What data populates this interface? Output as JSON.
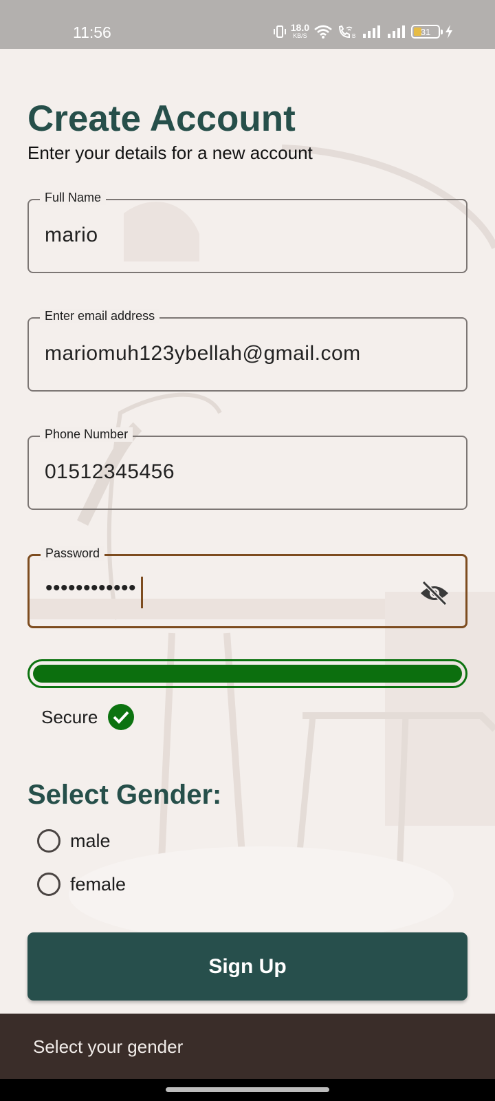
{
  "status_bar": {
    "time": "11:56",
    "net_speed_value": "18.0",
    "net_speed_unit": "KB/S",
    "battery_level": "31"
  },
  "header": {
    "title": "Create Account",
    "subtitle": "Enter your details for a new account"
  },
  "form": {
    "full_name": {
      "label": "Full Name",
      "value": "mario"
    },
    "email": {
      "label": "Enter email address",
      "value": "mariomuh123ybellah@gmail.com"
    },
    "phone": {
      "label": "Phone Number",
      "value": "01512345456"
    },
    "password": {
      "label": "Password",
      "value": "••••••••••••"
    }
  },
  "password_strength": {
    "level": 1.0,
    "label": "Secure",
    "color": "#0c7310"
  },
  "gender": {
    "title": "Select Gender:",
    "options": [
      "male",
      "female"
    ]
  },
  "signup_button": {
    "label": "Sign Up"
  },
  "snackbar": {
    "message": "Select your gender"
  },
  "colors": {
    "primary": "#274f4c",
    "accent": "#7d4c1f",
    "success": "#0c7310",
    "snackbar_bg": "#3a2d29"
  }
}
